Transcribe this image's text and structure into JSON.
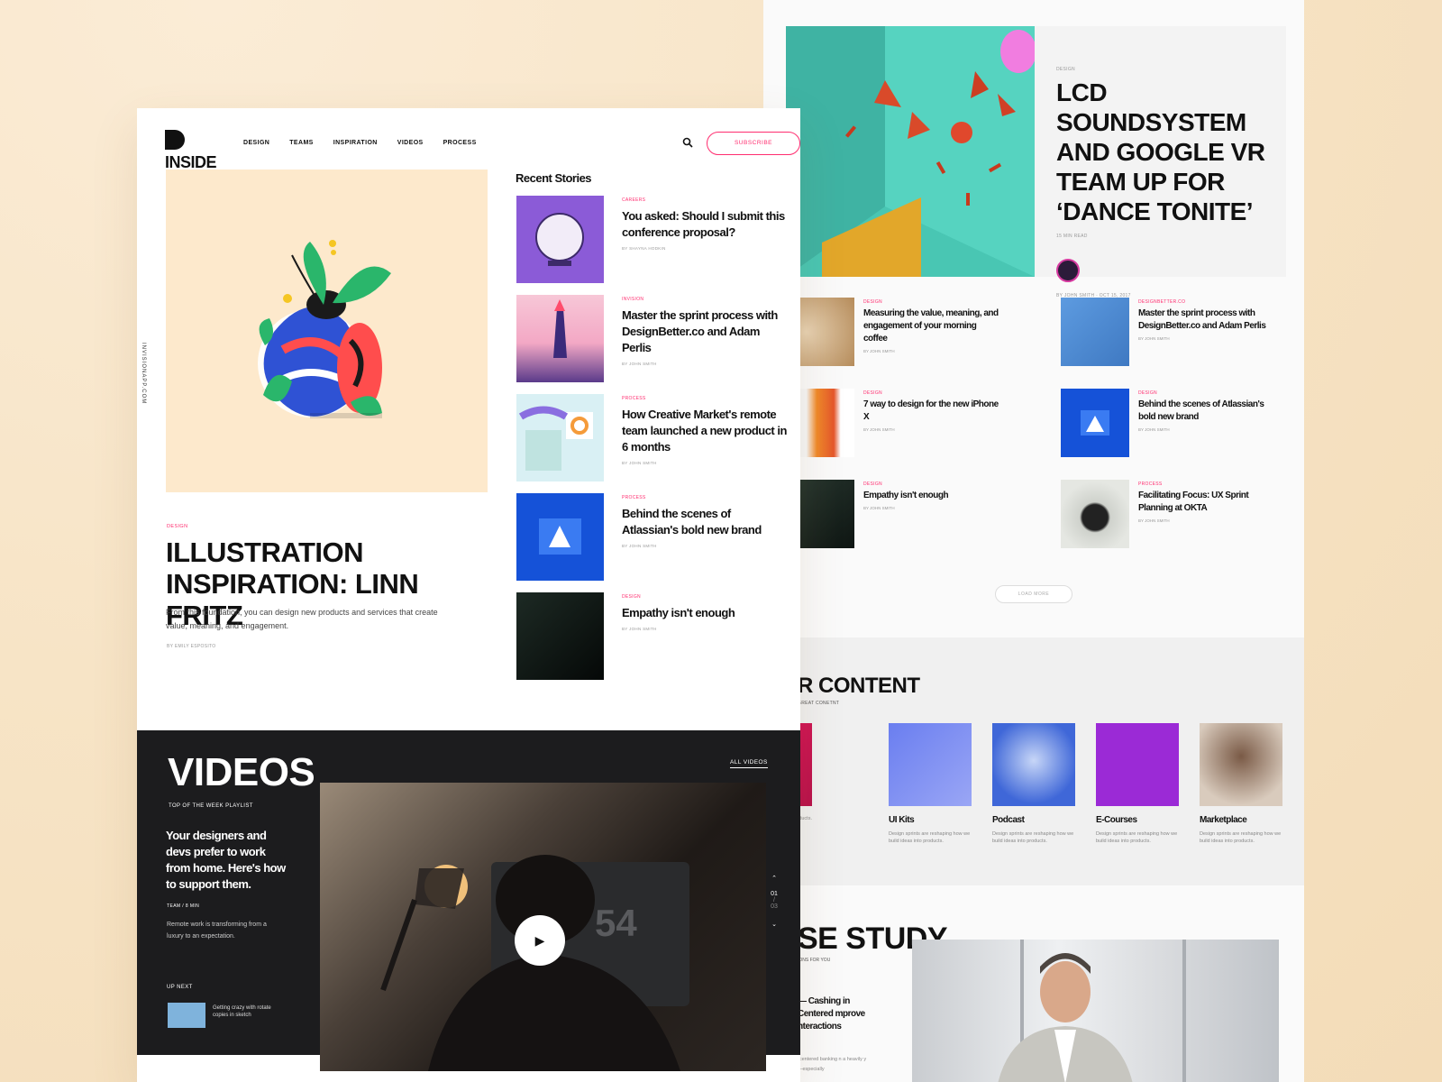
{
  "main": {
    "logo": {
      "name": "INSIDE DESIGN"
    },
    "nav": [
      "DESIGN",
      "TEAMS",
      "INSPIRATION",
      "VIDEOS",
      "PROCESS"
    ],
    "subscribe": "SUBSCRIBE",
    "side_url": "INVISIONAPP.COM",
    "featured": {
      "category": "DESIGN",
      "title": "ILLUSTRATION INSPIRATION: LINN FRITZ",
      "description": "From this foundation, you can design new products and services that create value, meaning, and engagement.",
      "byline": "BY EMILY ESPOSITO"
    },
    "recent": {
      "heading": "Recent Stories",
      "items": [
        {
          "category": "CAREERS",
          "title": "You asked: Should I submit this conference proposal?",
          "byline": "BY SHAYNA HODKIN"
        },
        {
          "category": "INVISION",
          "title": "Master the sprint process with DesignBetter.co and Adam Perlis",
          "byline": "BY JOHN SMITH"
        },
        {
          "category": "PROCESS",
          "title": "How Creative Market's remote team launched a new product in 6 months",
          "byline": "BY JOHN SMITH"
        },
        {
          "category": "PROCESS",
          "title": "Behind the scenes of Atlassian's bold new brand",
          "byline": "BY JOHN SMITH"
        },
        {
          "category": "DESIGN",
          "title": "Empathy isn't enough",
          "byline": "BY JOHN SMITH"
        }
      ]
    },
    "videos": {
      "heading": "VIDEOS",
      "subheading": "TOP OF THE WEEK PLAYLIST",
      "all_videos": "ALL VIDEOS",
      "title": "Your designers and devs prefer to work from home. Here's how to support them.",
      "meta": "TEAM / 8 MIN",
      "description": "Remote work is transforming from a luxury to an expectation.",
      "up_next_label": "UP NEXT",
      "up_next_title": "Getting crazy with rotate copies in sketch",
      "pager_current": "01",
      "pager_total": "03"
    }
  },
  "right": {
    "hero": {
      "category": "DESIGN",
      "title": "LCD SOUNDSYSTEM AND GOOGLE VR TEAM UP FOR ‘DANCE TONITE’",
      "read_time": "15 min read",
      "byline": "BY JOHN SMITH",
      "date": "OCT 15, 2017"
    },
    "grid": [
      {
        "category": "DESIGN",
        "title": "Measuring the value, meaning, and engagement of your morning coffee",
        "byline": "BY JOHN SMITH"
      },
      {
        "category": "DESIGNBETTER.CO",
        "title": "Master the sprint process with DesignBetter.co and Adam Perlis",
        "byline": "BY JOHN SMITH"
      },
      {
        "category": "DESIGN",
        "title": "7 way to design for the new iPhone X",
        "byline": "BY JOHN SMITH"
      },
      {
        "category": "DESIGN",
        "title": "Behind the scenes of Atlassian's bold new brand",
        "byline": "BY JOHN SMITH"
      },
      {
        "category": "DESIGN",
        "title": "Empathy isn't enough",
        "byline": "BY JOHN SMITH"
      },
      {
        "category": "PROCESS",
        "title": "Facilitating Focus: UX Sprint Planning at OKTA",
        "byline": "BY JOHN SMITH"
      }
    ],
    "load_more": "LOAD MORE",
    "content": {
      "heading": "R CONTENT",
      "subheading": "GREAT CONETNT",
      "cards": [
        {
          "name": "",
          "desc": "e reshaping how o products."
        },
        {
          "name": "UI Kits",
          "desc": "Design sprints are reshaping how we build ideas into products."
        },
        {
          "name": "Podcast",
          "desc": "Design sprints are reshaping how we build ideas into products."
        },
        {
          "name": "E-Courses",
          "desc": "Design sprints are reshaping how we build ideas into products."
        },
        {
          "name": "Marketplace",
          "desc": "Design sprints are reshaping how we build ideas into products."
        }
      ]
    },
    "case_study": {
      "heading": "SE STUDY",
      "subheading": "IONS FOR YOU",
      "title": "— Cashing in Centered mprove nteractions",
      "desc": "-centered banking n a heavily y—especially"
    }
  }
}
